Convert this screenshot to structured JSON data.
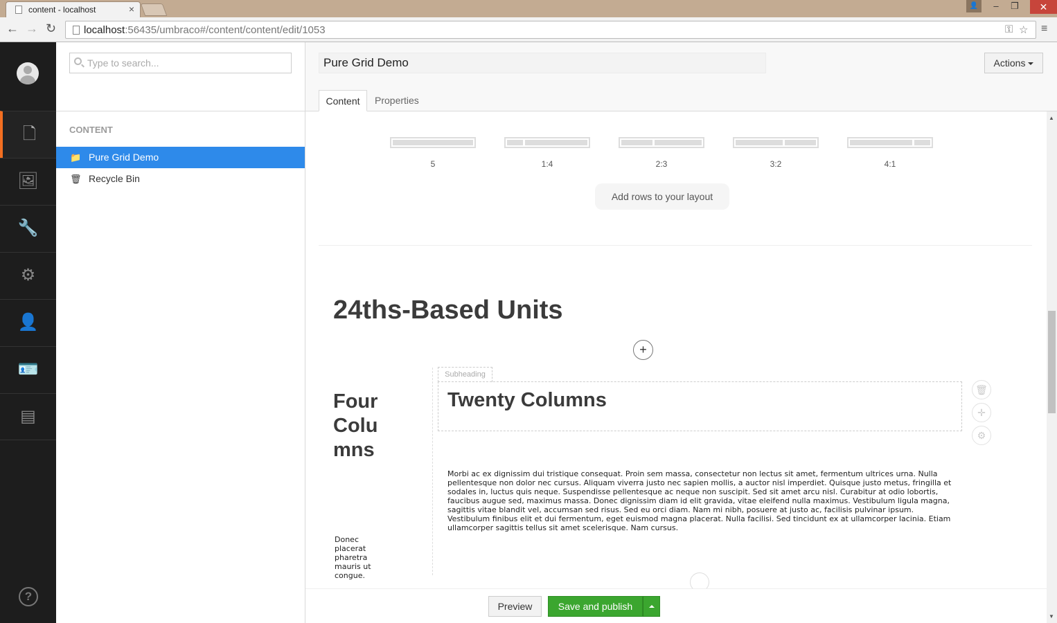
{
  "browser": {
    "tab_title": "content - localhost",
    "url_host": "localhost",
    "url_rest": ":56435/umbraco#/content/content/edit/1053"
  },
  "leftnav": {
    "items": [
      "content-icon",
      "media-icon",
      "developer-icon",
      "settings-icon",
      "users-icon",
      "members-icon",
      "forms-icon"
    ],
    "help": "?"
  },
  "tree": {
    "search_placeholder": "Type to search...",
    "section": "CONTENT",
    "items": [
      {
        "label": "Pure Grid Demo",
        "icon": "folder-icon",
        "selected": true
      },
      {
        "label": "Recycle Bin",
        "icon": "trash-icon",
        "selected": false
      }
    ]
  },
  "editor": {
    "name": "Pure Grid Demo",
    "actions_label": "Actions",
    "tabs": [
      "Content",
      "Properties"
    ]
  },
  "grid": {
    "layouts": [
      "5",
      "1:4",
      "2:3",
      "3:2",
      "4:1"
    ],
    "add_rows_label": "Add rows to your layout",
    "section_title": "24ths-Based Units",
    "left_column_title": "Four Columns",
    "left_column_text": "Donec placerat pharetra mauris ut congue.",
    "subheading_label": "Subheading",
    "right_heading": "Twenty Columns",
    "body_text": "Morbi ac ex dignissim dui tristique consequat. Proin sem massa, consectetur non lectus sit amet, fermentum ultrices urna. Nulla pellentesque non dolor nec cursus. Aliquam viverra justo nec sapien mollis, a auctor nisl imperdiet. Quisque justo metus, fringilla et sodales in, luctus quis neque. Suspendisse pellentesque ac neque non suscipit. Sed sit amet arcu nisl. Curabitur at odio lobortis, faucibus augue sed, maximus massa. Donec dignissim diam id elit gravida, vitae eleifend nulla maximus. Vestibulum ligula magna, sagittis vitae blandit vel, accumsan sed risus. Sed eu orci diam. Nam mi nibh, posuere at justo ac, facilisis pulvinar ipsum. Vestibulum finibus elit et dui fermentum, eget euismod magna placerat. Nulla facilisi. Sed tincidunt ex at ullamcorper lacinia. Etiam ullamcorper sagittis tellus sit amet scelerisque. Nam cursus."
  },
  "footer": {
    "preview_label": "Preview",
    "publish_label": "Save and publish"
  },
  "colors": {
    "selected": "#2e8aea",
    "publish": "#3ba62f",
    "active_section": "#f36f21",
    "leftnav_bg": "#1d1d1d"
  }
}
